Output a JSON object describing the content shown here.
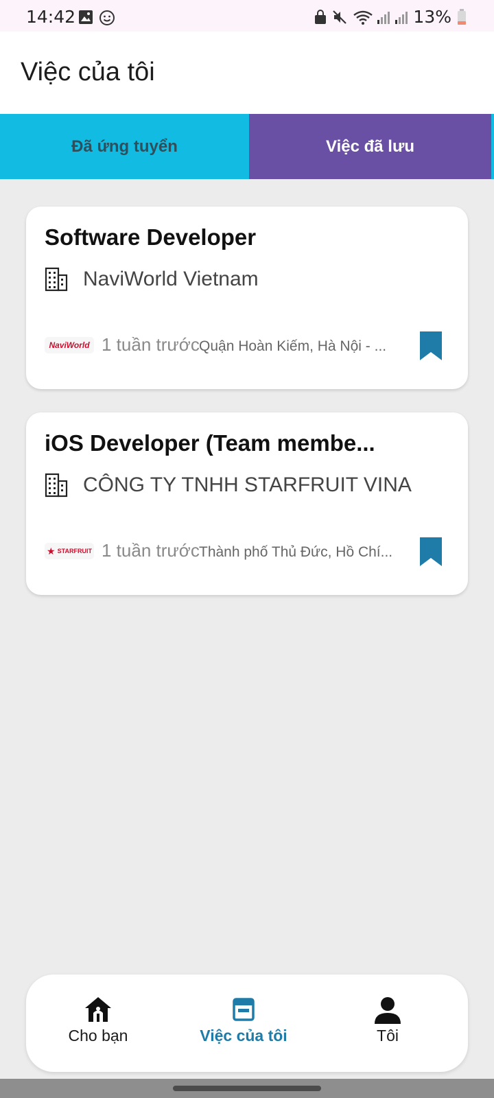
{
  "status_bar": {
    "time": "14:42",
    "battery": "13%"
  },
  "app_bar": {
    "title": "Việc của tôi"
  },
  "tabs": [
    {
      "label": "Đã ứng tuyển",
      "selected": false
    },
    {
      "label": "Việc đã lưu",
      "selected": true
    }
  ],
  "jobs": [
    {
      "title": "Software Developer",
      "company": "NaviWorld Vietnam",
      "logo_text": "NaviWorld",
      "posted": "1 tuần trước",
      "location": "Quận Hoàn Kiếm, Hà Nội - ..."
    },
    {
      "title": "iOS Developer (Team membe...",
      "company": "CÔNG TY TNHH STARFRUIT VINA",
      "logo_text": "STARFRUIT",
      "posted": "1 tuần trước",
      "location": "Thành phố Thủ Đức, Hồ Chí..."
    }
  ],
  "bottom_nav": [
    {
      "label": "Cho bạn",
      "icon": "home-icon",
      "active": false
    },
    {
      "label": "Việc của tôi",
      "icon": "calendar-icon",
      "active": true
    },
    {
      "label": "Tôi",
      "icon": "person-icon",
      "active": false
    }
  ],
  "colors": {
    "tab_bar": "#12bbe2",
    "tab_selected": "#6a50a5",
    "accent": "#1f7ba8",
    "background": "#ececec"
  }
}
